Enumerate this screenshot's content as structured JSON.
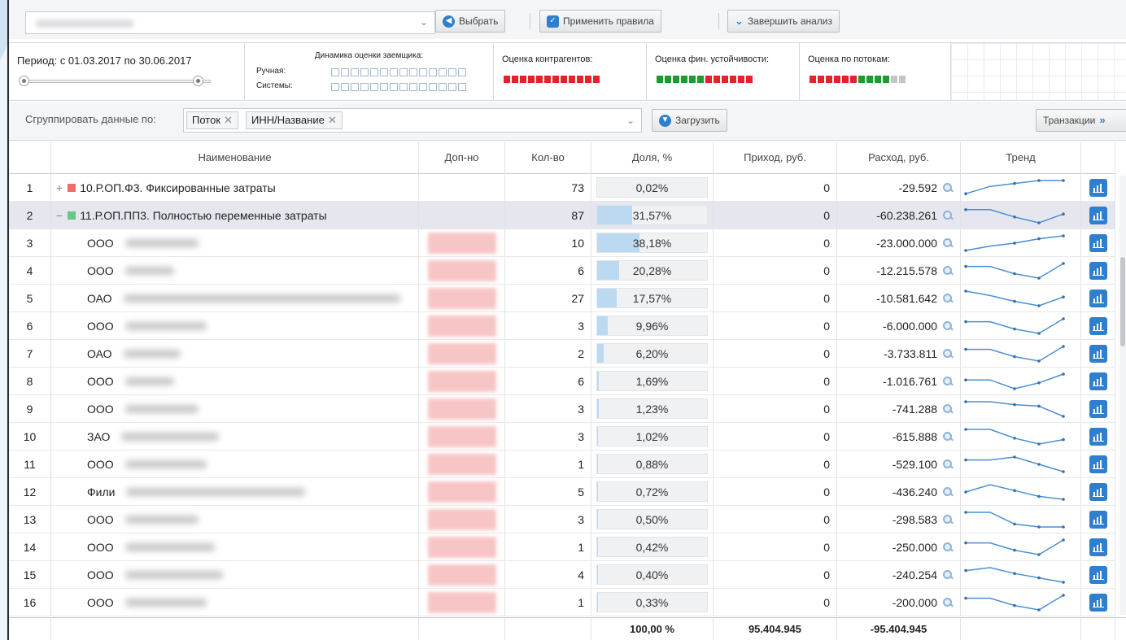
{
  "toolbar": {
    "select_label": "Выбрать",
    "apply_rules_label": "Применить правила",
    "finish_label": "Завершить анализ"
  },
  "assessment": {
    "period": "Период: с 01.03.2017 по 30.06.2017",
    "dynamics_title": "Динамика оценки заемщика:",
    "manual_label": "Ручная:",
    "system_label": "Системы:",
    "counterparties_title": "Оценка контрагентов:",
    "financial_title": "Оценка фин. устойчивости:",
    "flows_title": "Оценка по потокам:",
    "counterparties_dots": [
      "red",
      "red",
      "red",
      "red",
      "red",
      "red",
      "red",
      "red",
      "red",
      "red",
      "red",
      "red"
    ],
    "financial_dots": [
      "green",
      "green",
      "green",
      "green",
      "green",
      "green",
      "red",
      "red",
      "red",
      "red",
      "red",
      "red"
    ],
    "flows_dots": [
      "red",
      "red",
      "red",
      "red",
      "red",
      "red",
      "green",
      "green",
      "green",
      "green",
      "grey",
      "grey"
    ]
  },
  "grouping": {
    "label": "Сгруппировать данные по:",
    "tags": [
      "Поток",
      "ИНН/Название"
    ],
    "load_label": "Загрузить",
    "transactions_label": "Транзакции"
  },
  "table": {
    "headers": {
      "name": "Наименование",
      "extra": "Доп-но",
      "count": "Кол-во",
      "share": "Доля, %",
      "income": "Приход, руб.",
      "expense": "Расход, руб.",
      "trend": "Тренд"
    },
    "rows": [
      {
        "num": "1",
        "group": true,
        "expanded": false,
        "marker": "red",
        "name": "10.Р.ОП.Ф3. Фиксированные затраты",
        "count": "73",
        "share": "0,02%",
        "share_val": 0.02,
        "income": "0",
        "expense": "-29.592",
        "trend": [
          0.1,
          0.6,
          0.8,
          1.0,
          1.0
        ]
      },
      {
        "num": "2",
        "group": true,
        "expanded": true,
        "marker": "green",
        "name": "11.Р.ОП.ПП3. Полностью переменные затраты",
        "count": "87",
        "share": "31,57%",
        "share_val": 31.57,
        "income": "0",
        "expense": "-60.238.261",
        "trend": [
          0.9,
          0.9,
          0.4,
          0.0,
          0.6
        ]
      },
      {
        "num": "3",
        "prefix": "ООО",
        "count": "10",
        "share": "38,18%",
        "share_val": 38.18,
        "income": "0",
        "expense": "-23.000.000",
        "trend": [
          0.0,
          0.3,
          0.5,
          0.8,
          1.0
        ]
      },
      {
        "num": "4",
        "prefix": "ООО",
        "count": "6",
        "share": "20,28%",
        "share_val": 20.28,
        "income": "0",
        "expense": "-12.215.578",
        "trend": [
          0.8,
          0.8,
          0.3,
          0.0,
          1.0
        ]
      },
      {
        "num": "5",
        "prefix": "ОАО",
        "count": "27",
        "share": "17,57%",
        "share_val": 17.57,
        "income": "0",
        "expense": "-10.581.642",
        "trend": [
          1.0,
          0.7,
          0.3,
          0.0,
          0.6
        ]
      },
      {
        "num": "6",
        "prefix": "ООО",
        "count": "3",
        "share": "9,96%",
        "share_val": 9.96,
        "income": "0",
        "expense": "-6.000.000",
        "trend": [
          0.8,
          0.8,
          0.3,
          0.0,
          1.0
        ]
      },
      {
        "num": "7",
        "prefix": "ОАО",
        "count": "2",
        "share": "6,20%",
        "share_val": 6.2,
        "income": "0",
        "expense": "-3.733.811",
        "trend": [
          0.8,
          0.8,
          0.3,
          0.0,
          1.0
        ]
      },
      {
        "num": "8",
        "prefix": "ООО",
        "count": "6",
        "share": "1,69%",
        "share_val": 1.69,
        "income": "0",
        "expense": "-1.016.761",
        "trend": [
          0.6,
          0.6,
          0.0,
          0.4,
          1.0
        ]
      },
      {
        "num": "9",
        "prefix": "ООО",
        "count": "3",
        "share": "1,23%",
        "share_val": 1.23,
        "income": "0",
        "expense": "-741.288",
        "trend": [
          1.0,
          1.0,
          0.8,
          0.7,
          0.0
        ]
      },
      {
        "num": "10",
        "prefix": "ЗАО",
        "count": "3",
        "share": "1,02%",
        "share_val": 1.02,
        "income": "0",
        "expense": "-615.888",
        "trend": [
          1.0,
          1.0,
          0.4,
          0.0,
          0.3
        ]
      },
      {
        "num": "11",
        "prefix": "ООО",
        "count": "1",
        "share": "0,88%",
        "share_val": 0.88,
        "income": "0",
        "expense": "-529.100",
        "trend": [
          0.8,
          0.8,
          1.0,
          0.5,
          0.0
        ]
      },
      {
        "num": "12",
        "prefix": "Фили",
        "count": "5",
        "share": "0,72%",
        "share_val": 0.72,
        "income": "0",
        "expense": "-436.240",
        "trend": [
          0.5,
          1.0,
          0.6,
          0.2,
          0.0
        ]
      },
      {
        "num": "13",
        "prefix": "ООО",
        "count": "3",
        "share": "0,50%",
        "share_val": 0.5,
        "income": "0",
        "expense": "-298.583",
        "trend": [
          1.0,
          1.0,
          0.2,
          0.0,
          0.0
        ]
      },
      {
        "num": "14",
        "prefix": "ООО",
        "count": "1",
        "share": "0,42%",
        "share_val": 0.42,
        "income": "0",
        "expense": "-250.000",
        "trend": [
          0.8,
          0.8,
          0.3,
          0.0,
          1.0
        ]
      },
      {
        "num": "15",
        "prefix": "ООО",
        "count": "4",
        "share": "0,40%",
        "share_val": 0.4,
        "income": "0",
        "expense": "-240.254",
        "trend": [
          0.8,
          1.0,
          0.6,
          0.3,
          0.0
        ]
      },
      {
        "num": "16",
        "prefix": "ООО",
        "count": "1",
        "share": "0,33%",
        "share_val": 0.33,
        "income": "0",
        "expense": "-200.000",
        "trend": [
          0.8,
          0.8,
          0.3,
          0.0,
          1.0
        ]
      }
    ],
    "totals": {
      "share": "100,00 %",
      "income": "95.404.945",
      "expense": "-95.404.945"
    }
  },
  "colors": {
    "red": "#e8202a",
    "green": "#1f9a2e",
    "grey": "#c3c5c8",
    "marker_red": "#f06a6a",
    "marker_green": "#6cc48a",
    "accent": "#2e7fd0",
    "trend_line": "#4a8fd4"
  }
}
